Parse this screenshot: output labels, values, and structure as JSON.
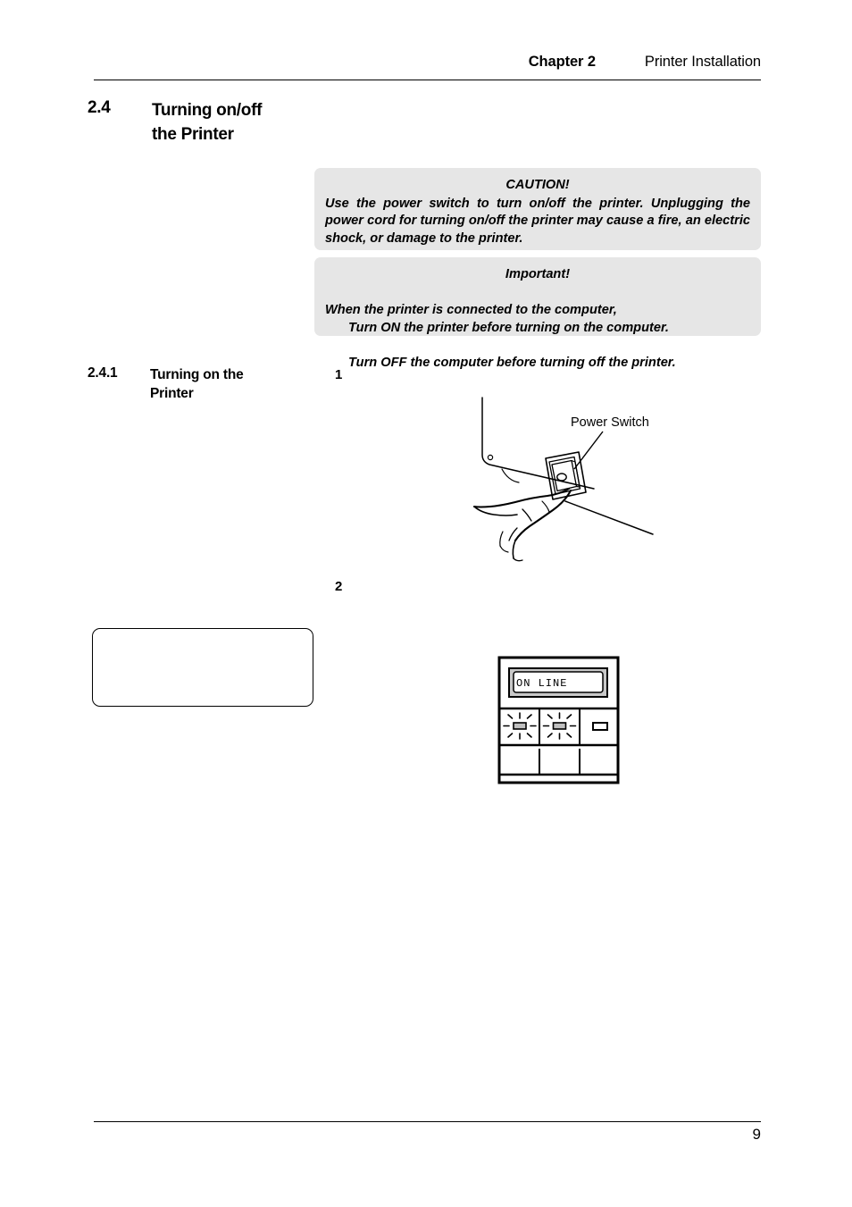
{
  "header": {
    "chapter_label": "Chapter 2",
    "title": "Printer Installation"
  },
  "section": {
    "number": "2.4",
    "title": "Turning on/off\nthe Printer"
  },
  "caution": {
    "title": "CAUTION!",
    "body": "Use the power switch to turn on/off the printer.  Unplugging the power cord for turning on/off the printer may cause a fire, an electric shock, or damage to the printer."
  },
  "important": {
    "title": "Important!",
    "line1": "When the printer is connected to the computer,",
    "line2": "Turn ON the printer before turning on the computer.",
    "line3": "Turn OFF the computer before turning off the printer."
  },
  "subsection": {
    "number": "2.4.1",
    "title": "Turning on the\nPrinter"
  },
  "steps": {
    "step_1": "1",
    "step_2": "2"
  },
  "figure_power_switch": {
    "callout_label": "Power Switch",
    "name": "printer-side-panel-hand-pressing-power-switch"
  },
  "figure_control_panel": {
    "lcd_text": "ON LINE",
    "name": "printer-operation-panel",
    "indicators": [
      {
        "name": "led-blinking-1",
        "state": "blinking"
      },
      {
        "name": "led-blinking-2",
        "state": "blinking"
      },
      {
        "name": "led-steady-3",
        "state": "steady"
      }
    ]
  },
  "note_box": {
    "text": ""
  },
  "footer": {
    "page_number": "9"
  },
  "colors": {
    "notice_background": "#e6e6e6",
    "text": "#000000",
    "lcd_bezel": "#c8c8c8",
    "led_fill": "#c0c0c0"
  }
}
